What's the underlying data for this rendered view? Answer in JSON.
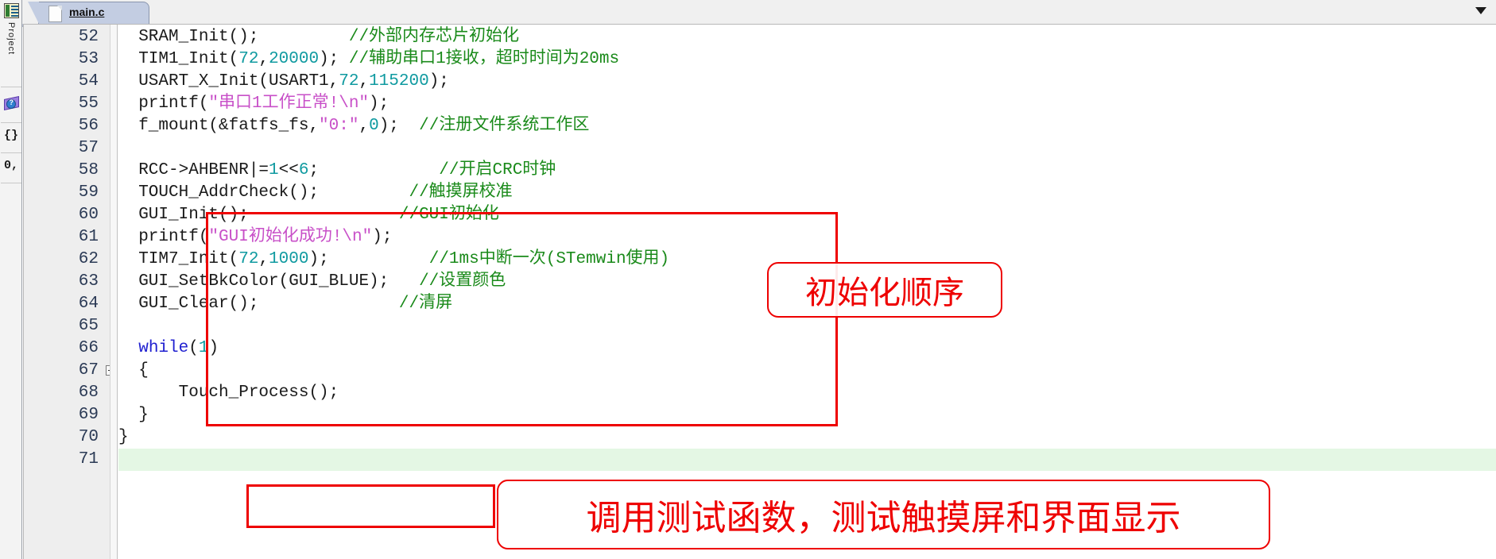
{
  "window": {
    "title": "main.c",
    "tab_label": "main.c",
    "tab_doc_icon": "document-icon",
    "dropdown_icon": "chevron-down-icon"
  },
  "left_toolbar": {
    "items": [
      {
        "name": "project-panel",
        "label": "Project",
        "icon": "project-window-icon"
      },
      {
        "name": "books-panel",
        "label": "",
        "icon": "books-help-icon"
      },
      {
        "name": "functions-panel",
        "label": "{}",
        "icon": "functions-braces-icon"
      },
      {
        "name": "templates-panel",
        "label": "0,",
        "icon": "templates-icon"
      }
    ]
  },
  "editor": {
    "first_line": 52,
    "highlight_line": 71,
    "lines": [
      {
        "num": "52",
        "tokens": [
          {
            "t": "  SRAM_Init();",
            "c": "p"
          },
          {
            "t": "         //外部内存芯片初始化",
            "c": "c"
          }
        ]
      },
      {
        "num": "53",
        "tokens": [
          {
            "t": "  TIM1_Init(",
            "c": "p"
          },
          {
            "t": "72",
            "c": "n"
          },
          {
            "t": ",",
            "c": "p"
          },
          {
            "t": "20000",
            "c": "n"
          },
          {
            "t": "); ",
            "c": "p"
          },
          {
            "t": "//辅助串口1接收，超时时间为20ms",
            "c": "c"
          }
        ]
      },
      {
        "num": "54",
        "tokens": [
          {
            "t": "  USART_X_Init(USART1,",
            "c": "p"
          },
          {
            "t": "72",
            "c": "n"
          },
          {
            "t": ",",
            "c": "p"
          },
          {
            "t": "115200",
            "c": "n"
          },
          {
            "t": ");",
            "c": "p"
          }
        ]
      },
      {
        "num": "55",
        "tokens": [
          {
            "t": "  printf(",
            "c": "p"
          },
          {
            "t": "\"串口1工作正常!\\n\"",
            "c": "s"
          },
          {
            "t": ");",
            "c": "p"
          }
        ]
      },
      {
        "num": "56",
        "tokens": [
          {
            "t": "  f_mount(&fatfs_fs,",
            "c": "p"
          },
          {
            "t": "\"0:\"",
            "c": "s"
          },
          {
            "t": ",",
            "c": "p"
          },
          {
            "t": "0",
            "c": "n"
          },
          {
            "t": ");  ",
            "c": "p"
          },
          {
            "t": "//注册文件系统工作区",
            "c": "c"
          }
        ]
      },
      {
        "num": "57",
        "tokens": []
      },
      {
        "num": "58",
        "tokens": [
          {
            "t": "  RCC->AHBENR|=",
            "c": "p"
          },
          {
            "t": "1",
            "c": "n"
          },
          {
            "t": "<<",
            "c": "p"
          },
          {
            "t": "6",
            "c": "n"
          },
          {
            "t": ";            ",
            "c": "p"
          },
          {
            "t": "//开启CRC时钟",
            "c": "c"
          }
        ]
      },
      {
        "num": "59",
        "tokens": [
          {
            "t": "  TOUCH_AddrCheck();         ",
            "c": "p"
          },
          {
            "t": "//触摸屏校准",
            "c": "c"
          }
        ]
      },
      {
        "num": "60",
        "tokens": [
          {
            "t": "  GUI_Init();               ",
            "c": "p"
          },
          {
            "t": "//GUI初始化",
            "c": "c"
          }
        ]
      },
      {
        "num": "61",
        "tokens": [
          {
            "t": "  printf(",
            "c": "p"
          },
          {
            "t": "\"GUI初始化成功!\\n\"",
            "c": "s"
          },
          {
            "t": ");",
            "c": "p"
          }
        ]
      },
      {
        "num": "62",
        "tokens": [
          {
            "t": "  TIM7_Init(",
            "c": "p"
          },
          {
            "t": "72",
            "c": "n"
          },
          {
            "t": ",",
            "c": "p"
          },
          {
            "t": "1000",
            "c": "n"
          },
          {
            "t": ");          ",
            "c": "p"
          },
          {
            "t": "//1ms中断一次(STemwin使用)",
            "c": "c"
          }
        ]
      },
      {
        "num": "63",
        "tokens": [
          {
            "t": "  GUI_SetBkColor(GUI_BLUE);   ",
            "c": "p"
          },
          {
            "t": "//设置颜色",
            "c": "c"
          }
        ]
      },
      {
        "num": "64",
        "tokens": [
          {
            "t": "  GUI_Clear();              ",
            "c": "p"
          },
          {
            "t": "//清屏",
            "c": "c"
          }
        ]
      },
      {
        "num": "65",
        "tokens": []
      },
      {
        "num": "66",
        "tokens": [
          {
            "t": "  ",
            "c": "p"
          },
          {
            "t": "while",
            "c": "k"
          },
          {
            "t": "(",
            "c": "p"
          },
          {
            "t": "1",
            "c": "n"
          },
          {
            "t": ")",
            "c": "p"
          }
        ]
      },
      {
        "num": "67",
        "tokens": [
          {
            "t": "  {",
            "c": "p"
          }
        ],
        "fold": true
      },
      {
        "num": "68",
        "tokens": [
          {
            "t": "      Touch_Process();",
            "c": "p"
          }
        ]
      },
      {
        "num": "69",
        "tokens": [
          {
            "t": "  }",
            "c": "p"
          }
        ],
        "foldtick": true
      },
      {
        "num": "70",
        "tokens": [
          {
            "t": "}",
            "c": "p"
          }
        ]
      },
      {
        "num": "71",
        "tokens": [],
        "highlight": true
      }
    ]
  },
  "annotations": {
    "color": "#ee0000",
    "boxes": [
      {
        "name": "init-sequence-highlight-box",
        "shape": "rectangle",
        "target": "lines 58-64"
      },
      {
        "name": "touch-process-highlight-box",
        "shape": "rectangle",
        "target": "line 68"
      }
    ],
    "callouts": [
      {
        "name": "init-sequence-callout",
        "text": "初始化顺序"
      },
      {
        "name": "touch-process-callout",
        "text": "调用测试函数，测试触摸屏和界面显示"
      }
    ]
  },
  "colors": {
    "keyword": "#2020d0",
    "number": "#0f9aa0",
    "string": "#c850c8",
    "comment": "#1a8a1a",
    "plain": "#1a1a1a",
    "annotation": "#ee0000",
    "tab_active": "#c3cde2",
    "gutter": "#eeeeee",
    "highlight_row": "#e4f7e4"
  }
}
